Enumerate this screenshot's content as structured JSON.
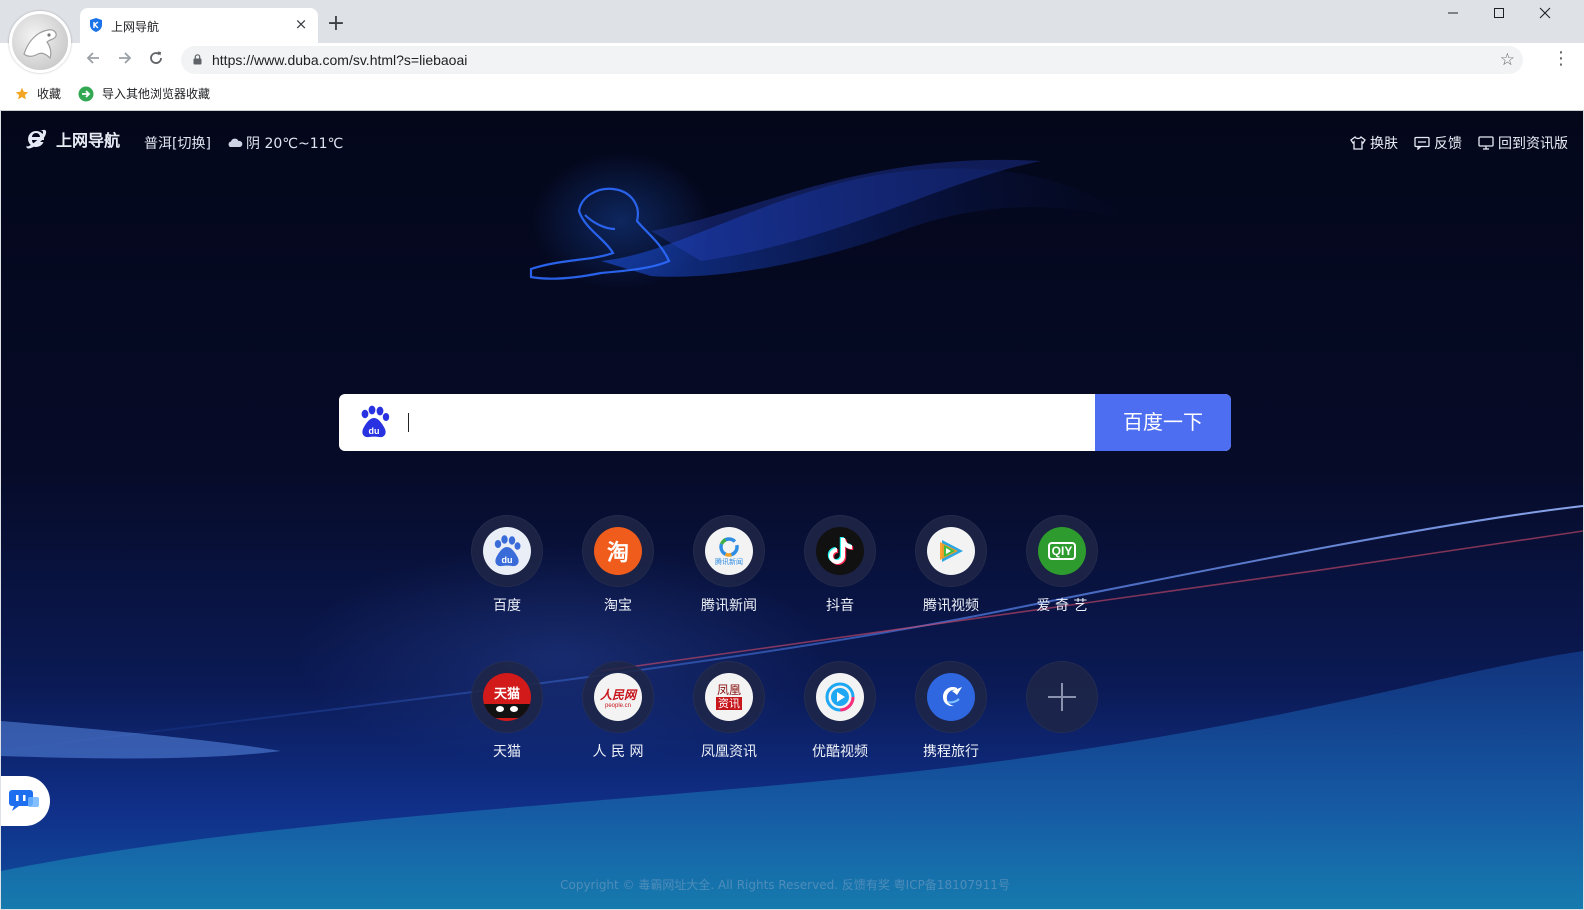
{
  "browser": {
    "tab_title": "上网导航",
    "tab_close": "×",
    "new_tab": "+",
    "url": "https://www.duba.com/sv.html?s=liebaoai",
    "bookmarks": [
      {
        "label": "收藏",
        "icon": "star-icon"
      },
      {
        "label": "导入其他浏览器收藏",
        "icon": "import-icon"
      }
    ],
    "window_controls": {
      "minimize": "—",
      "maximize": "☐",
      "close": "✕"
    }
  },
  "header": {
    "logo_text": "上网导航",
    "city": "普洱[切换]",
    "weather": "阴 20℃~11℃",
    "links": [
      {
        "label": "换肤",
        "icon": "shirt-icon"
      },
      {
        "label": "反馈",
        "icon": "feedback-icon"
      },
      {
        "label": "回到资讯版",
        "icon": "monitor-icon"
      }
    ]
  },
  "search": {
    "engine_icon": "baidu-paw-icon",
    "query": "",
    "button_label": "百度一下"
  },
  "sites": [
    {
      "label": "百度",
      "icon": "baidu-icon",
      "color": "#e9eef7"
    },
    {
      "label": "淘宝",
      "icon": "taobao-icon",
      "color": "#f05c1c"
    },
    {
      "label": "腾讯新闻",
      "icon": "tencent-news-icon",
      "color": "#f3f3f3"
    },
    {
      "label": "抖音",
      "icon": "douyin-icon",
      "color": "#111111"
    },
    {
      "label": "腾讯视频",
      "icon": "tencent-video-icon",
      "color": "#f3f3f3"
    },
    {
      "label": "爱 奇 艺",
      "icon": "iqiyi-icon",
      "color": "#2e9b2e"
    },
    {
      "label": "天猫",
      "icon": "tmall-icon",
      "color": "#d21a1a"
    },
    {
      "label": "人 民 网",
      "icon": "people-icon",
      "color": "#f3f3f3"
    },
    {
      "label": "凤凰资讯",
      "icon": "ifeng-icon",
      "color": "#f3f3f3"
    },
    {
      "label": "优酷视频",
      "icon": "youku-icon",
      "color": "#f3f3f3"
    },
    {
      "label": "携程旅行",
      "icon": "ctrip-icon",
      "color": "#2f67e0"
    }
  ],
  "add_site_icon": "plus-icon",
  "tile_texts": {
    "taobao": "淘",
    "iqiyi": "QIY",
    "tmall": "天猫",
    "people": "人民网",
    "people_sub": "people.cn",
    "ifeng_top": "凤凰",
    "ifeng_bottom": "资讯",
    "tencent_news": "腾讯新闻"
  },
  "footer": {
    "copyright": "Copyright © 毒霸网址大全. All Rights Reserved. 反馈有奖 粤ICP备18107911号"
  }
}
